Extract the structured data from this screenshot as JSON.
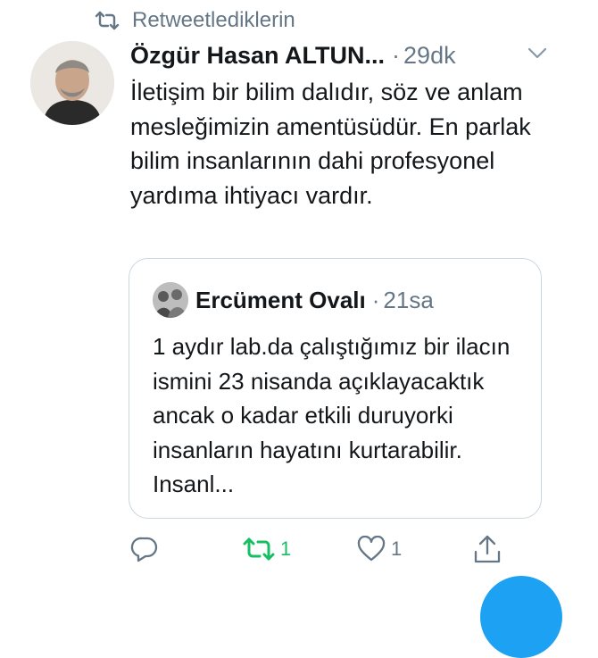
{
  "retweet_context": {
    "label": "Retweetlediklerin",
    "icon": "retweet-icon"
  },
  "tweet": {
    "author": "Özgür Hasan ALTUN...",
    "separator": "·",
    "time": "29dk",
    "text": "İletişim bir bilim dalıdır, söz ve anlam mesleğimizin amentüsüdür. En parlak bilim insanlarının dahi profesyonel yardıma ihtiyacı vardır."
  },
  "quoted_tweet": {
    "author": "Ercüment Ovalı",
    "separator": "·",
    "time": "21sa",
    "text": "1 aydır lab.da çalıştığımız bir ilacın ismini 23 nisanda açıklayacaktık ancak o kadar etkili duruyorki insanların hayatını kurtarabilir.  Insanl..."
  },
  "actions": {
    "reply": {
      "icon": "reply-icon"
    },
    "retweet": {
      "icon": "retweet-icon",
      "count": "1",
      "active": true
    },
    "like": {
      "icon": "heart-icon",
      "count": "1"
    },
    "share": {
      "icon": "share-icon"
    }
  },
  "colors": {
    "text": "#14171a",
    "secondary": "#657786",
    "retweet_active": "#17bf63",
    "accent": "#1da1f2",
    "border": "#ccd6dd"
  }
}
